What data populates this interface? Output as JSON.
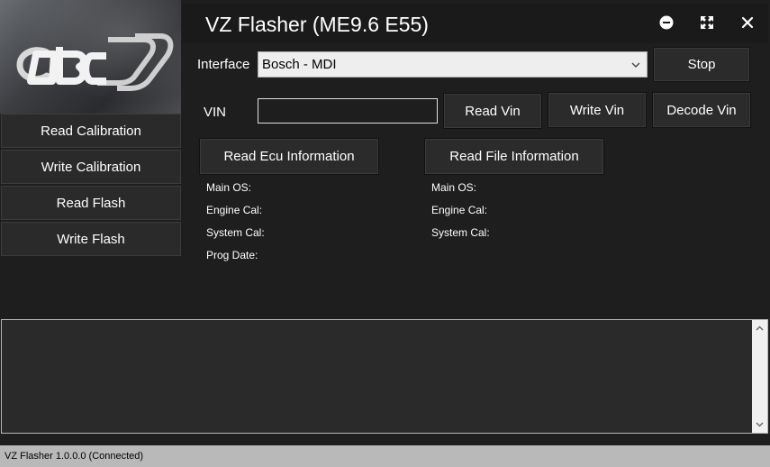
{
  "app": {
    "title": "VZ Flasher (ME9.6 E55)",
    "logo_text": "OBCD"
  },
  "window_controls": {
    "minimize_icon": "minus-circle-icon",
    "maximize_icon": "expand-arrows-icon",
    "close_icon": "close-x-icon"
  },
  "sidebar": {
    "items": [
      {
        "label": "Read Calibration"
      },
      {
        "label": "Write Calibration"
      },
      {
        "label": "Read Flash"
      },
      {
        "label": "Write Flash"
      }
    ]
  },
  "interface": {
    "label": "Interface",
    "selected": "Bosch - MDI",
    "stop_label": "Stop"
  },
  "vin": {
    "label": "VIN",
    "value": "",
    "read_label": "Read Vin",
    "write_label": "Write Vin",
    "decode_label": "Decode Vin"
  },
  "ecu_info": {
    "button_label": "Read Ecu Information",
    "fields": [
      {
        "label": "Main OS:"
      },
      {
        "label": "Engine Cal:"
      },
      {
        "label": "System Cal:"
      },
      {
        "label": "Prog Date:"
      }
    ]
  },
  "file_info": {
    "button_label": "Read File Information",
    "fields": [
      {
        "label": "Main OS:"
      },
      {
        "label": "Engine Cal:"
      },
      {
        "label": "System Cal:"
      }
    ]
  },
  "log": {
    "text": ""
  },
  "status_bar": {
    "text": "VZ Flasher 1.0.0.0 (Connected)"
  },
  "colors": {
    "background": "#1e1e1e",
    "button": "#2b2b2b",
    "status_bar": "#b9b9b9"
  }
}
